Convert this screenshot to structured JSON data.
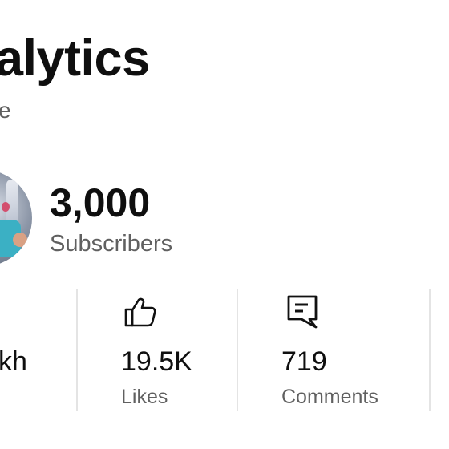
{
  "header": {
    "title": "alytics",
    "subtitle": "e"
  },
  "channel": {
    "subscriber_count": "3,000",
    "subscriber_label": "Subscribers"
  },
  "stats": [
    {
      "value": "kh",
      "label": "",
      "icon": ""
    },
    {
      "value": "19.5K",
      "label": "Likes",
      "icon": "thumbs-up-icon"
    },
    {
      "value": "719",
      "label": "Comments",
      "icon": "comment-icon"
    }
  ]
}
